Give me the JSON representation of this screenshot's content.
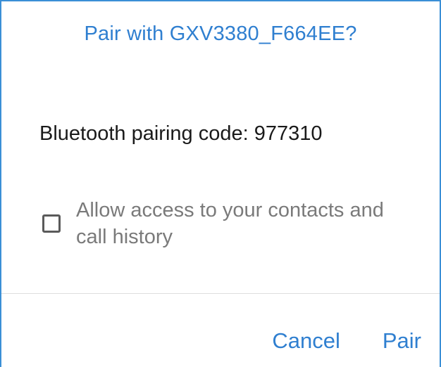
{
  "dialog": {
    "title": "Pair with GXV3380_F664EE?",
    "pairing_code_text": "Bluetooth pairing code: 977310",
    "checkbox": {
      "label": "Allow access to your contacts and call history",
      "checked": false
    },
    "buttons": {
      "cancel_label": "Cancel",
      "pair_label": "Pair"
    }
  },
  "colors": {
    "accent": "#2f7fd0",
    "text_primary": "#1a1a1a",
    "text_secondary": "#7a7a7a",
    "divider": "#dedede"
  }
}
